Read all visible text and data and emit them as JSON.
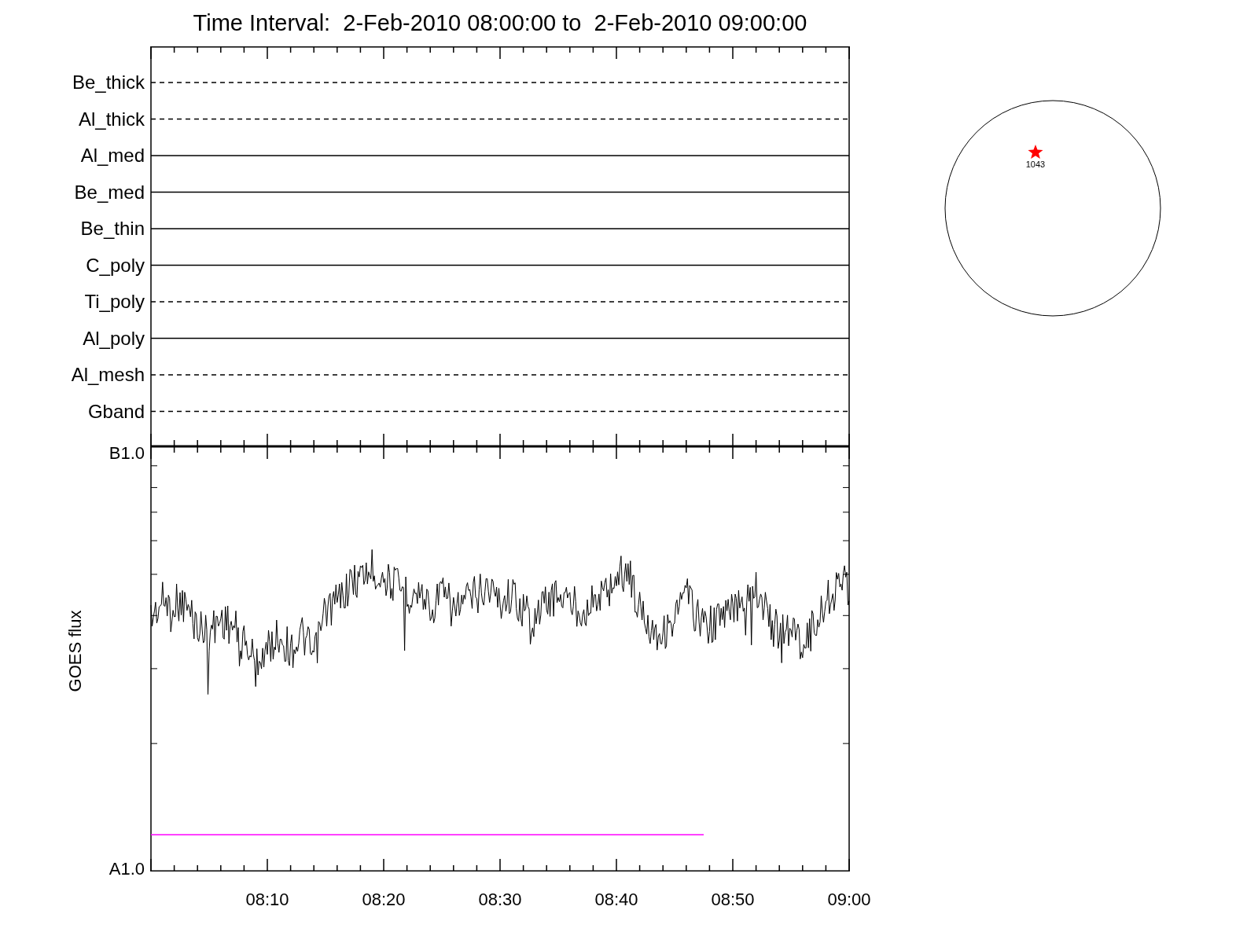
{
  "title": "Time Interval:  2-Feb-2010 08:00:00 to  2-Feb-2010 09:00:00",
  "filters": [
    {
      "label": "Be_thick",
      "kind": "dashed"
    },
    {
      "label": "Al_thick",
      "kind": "dashed"
    },
    {
      "label": "Al_med",
      "kind": "solid"
    },
    {
      "label": "Be_med",
      "kind": "solid"
    },
    {
      "label": "Be_thin",
      "kind": "solid"
    },
    {
      "label": "C_poly",
      "kind": "solid"
    },
    {
      "label": "Ti_poly",
      "kind": "dashed"
    },
    {
      "label": "Al_poly",
      "kind": "solid"
    },
    {
      "label": "Al_mesh",
      "kind": "dashed"
    },
    {
      "label": "Gband",
      "kind": "dashed"
    }
  ],
  "goes": {
    "ylabel": "GOES flux",
    "y_labels": [
      "B1.0",
      "A1.0"
    ],
    "x_labels": [
      "08:10",
      "08:20",
      "08:30",
      "08:40",
      "08:50",
      "09:00"
    ]
  },
  "sun_map": {
    "marker_label": "1043"
  }
}
